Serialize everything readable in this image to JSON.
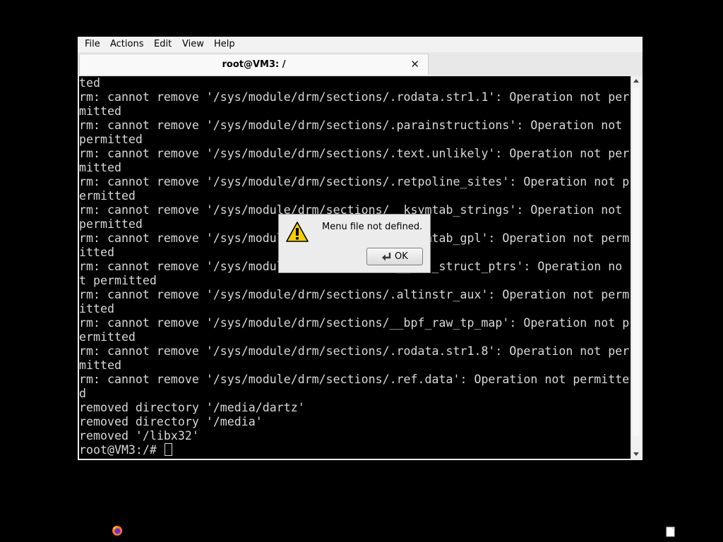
{
  "window": {
    "menu": [
      "File",
      "Actions",
      "Edit",
      "View",
      "Help"
    ],
    "tab_title": "root@VM3: /",
    "tab_close_glyph": "✕"
  },
  "terminal": {
    "lines": [
      "ted",
      "rm: cannot remove '/sys/module/drm/sections/.rodata.str1.1': Operation not per",
      "mitted",
      "rm: cannot remove '/sys/module/drm/sections/.parainstructions': Operation not",
      "permitted",
      "rm: cannot remove '/sys/module/drm/sections/.text.unlikely': Operation not per",
      "mitted",
      "rm: cannot remove '/sys/module/drm/sections/.retpoline_sites': Operation not p",
      "ermitted",
      "rm: cannot remove '/sys/module/drm/sections/__ksymtab_strings': Operation not",
      "permitted",
      "rm: cannot remove '/sys/module/drm/sections/__ksymtab_gpl': Operation not perm",
      "itted",
      "rm: cannot remove '/sys/module/drm/sections/.__bug_struct_ptrs': Operation no",
      "t permitted",
      "rm: cannot remove '/sys/module/drm/sections/.altinstr_aux': Operation not perm",
      "itted",
      "rm: cannot remove '/sys/module/drm/sections/__bpf_raw_tp_map': Operation not p",
      "ermitted",
      "rm: cannot remove '/sys/module/drm/sections/.rodata.str1.8': Operation not per",
      "mitted",
      "rm: cannot remove '/sys/module/drm/sections/.ref.data': Operation not permitte",
      "d",
      "removed directory '/media/dartz'",
      "removed directory '/media'",
      "removed '/libx32'"
    ],
    "prompt": "root@VM3:/# "
  },
  "dialog": {
    "message": "Menu file not defined.",
    "ok_label": "OK",
    "icon": "warning-icon"
  },
  "taskbar": {
    "left_icon": "firefox-icon",
    "right_icon": "notes-icon"
  },
  "colors": {
    "desktop": "#000000",
    "terminal_bg": "#000000",
    "terminal_fg": "#d8d8d8",
    "warning_yellow": "#f5d000"
  }
}
